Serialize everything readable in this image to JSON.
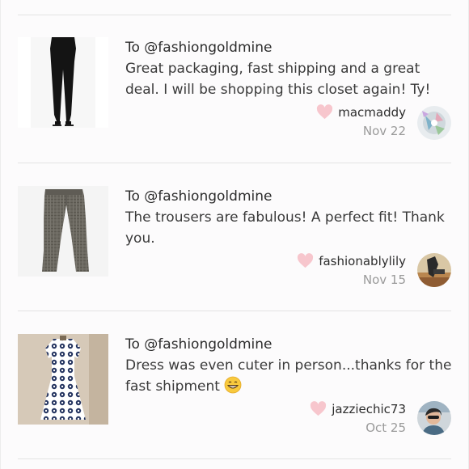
{
  "reviews": [
    {
      "to": "To @fashiongoldmine",
      "message": "Great packaging, fast shipping and a great deal. I will be shopping this closet again! Ty!",
      "username": "macmaddy",
      "date": "Nov 22",
      "product_image": "black-skinny-pants-photo",
      "avatar_image": "user-avatar-photo"
    },
    {
      "to": "To @fashiongoldmine",
      "message": "The trousers are fabulous! A perfect fit! Thank you.",
      "username": "fashionablylily",
      "date": "Nov 15",
      "product_image": "gray-plaid-trousers-photo",
      "avatar_image": "user-avatar-photo"
    },
    {
      "to": "To @fashiongoldmine",
      "message": "Dress was even cuter in person...thanks for the fast shipment",
      "username": "jazziechic73",
      "date": "Oct 25",
      "product_image": "blue-print-dress-photo",
      "avatar_image": "user-avatar-photo",
      "emoji": "grinning-face-icon"
    }
  ],
  "colors": {
    "heart": "#f7c6cd",
    "date_text": "#9a9a9a",
    "divider": "#e3e3e3"
  }
}
